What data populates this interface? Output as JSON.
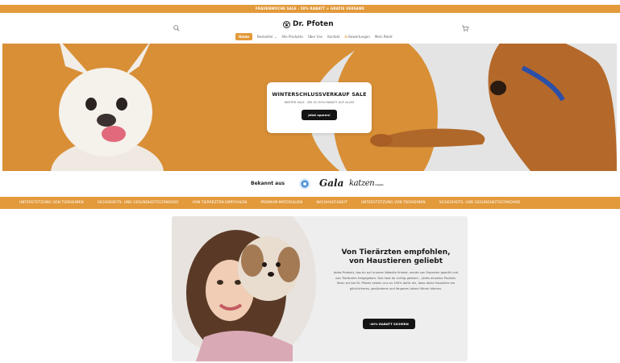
{
  "announcement": {
    "text": "FRAUENWOCHE SALE - 50% RABATT + GRATIS VERSAND"
  },
  "header": {
    "logo_text": "Dr. Pfoten",
    "search_icon": "search-icon",
    "cart_icon": "cart-icon",
    "nav": [
      {
        "label": "Home"
      },
      {
        "label": "Bestseller ⌄"
      },
      {
        "label": "Alle Produkte"
      },
      {
        "label": "Über Uns"
      },
      {
        "label": "Kontakt"
      },
      {
        "label": "Bewertungen"
      },
      {
        "label": "Mein Paket"
      }
    ]
  },
  "hero": {
    "title": "WINTERSCHLUSSVERKAUF SALE",
    "subtitle": "WINTER SALE - BIS ZU 50% RABATT AUF ALLES",
    "cta": "Jetzt sparen!"
  },
  "press": {
    "label": "Bekannt aus",
    "logos": [
      "Gala",
      "katzen",
      "magazin"
    ]
  },
  "ticker": {
    "items": [
      "UNTERSTÜTZUNG VON TIERHEIMEN",
      "SICHERHEITS- UND GESUNDHEITSSTANDARD",
      "VON TIERÄRZTEN EMPFOHLEN",
      "PREMIUM-MATERIALIEN",
      "NACHHALTIGKEIT",
      "UNTERSTÜTZUNG VON TIERHEIMEN",
      "SICHERHEITS- UND GESUNDHEITSSTANDARD"
    ]
  },
  "feature": {
    "title_line1": "Von Tierärzten empfohlen,",
    "title_line2": "von Haustieren geliebt",
    "body": "Jedes Produkt, das du auf unserer Website findest, wurde von Experten geprüft und von Tierärzten freigegeben. Das hast du richtig gelesen – jedes einzelne Produkt. Denn wir bei Dr. Pfoten setzen uns zu 100% dafür ein, dass deine Haustiere ein glücklicheres, gesünderes und längeres Leben führen können.",
    "cta": "-40% RABATT SICHERN"
  },
  "colors": {
    "accent": "#e39a3b",
    "dark": "#141414"
  }
}
